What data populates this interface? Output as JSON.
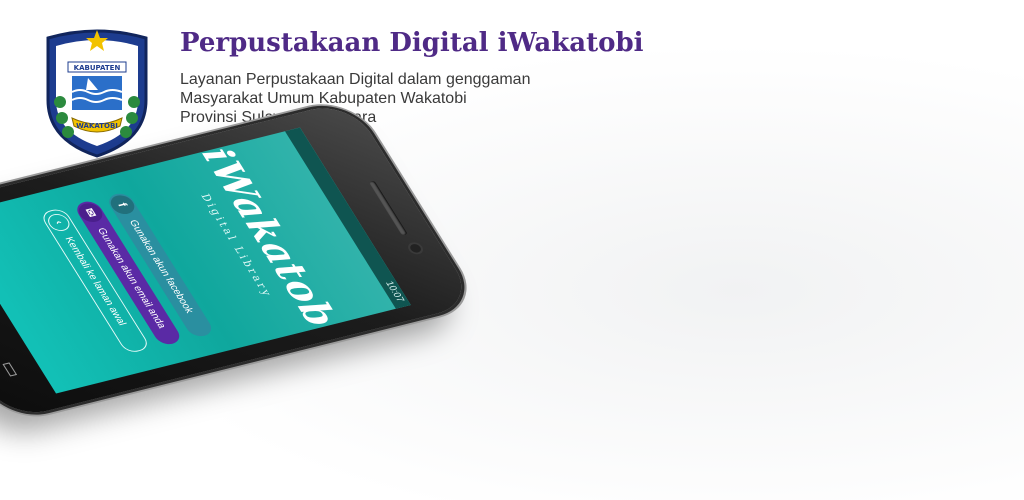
{
  "header": {
    "title": "Perpustakaan Digital iWakatobi",
    "subtitle_lines": [
      "Layanan Perpustakaan Digital dalam genggaman",
      "Masyarakat Umum Kabupaten Wakatobi",
      "Provinsi Sulawesi Tenggara"
    ]
  },
  "emblem": {
    "top_text": "KABUPATEN",
    "bottom_text": "WAKATOBI"
  },
  "phone": {
    "status_time": "10:07",
    "logo_text": "iWakatobi",
    "logo_subtext": "Digital Library",
    "buttons": {
      "facebook": "Gunakan akun facebook",
      "email": "Gunakan akun email anda",
      "back": "Kembali ke laman awal"
    },
    "icons": {
      "facebook": "facebook-icon",
      "email": "email-icon",
      "back": "back-arrow-icon"
    }
  },
  "colors": {
    "title": "#4f2a86",
    "screen_teal": "#12b2a8",
    "facebook_button": "#2a8fa0",
    "email_button": "#5a2aa5"
  }
}
